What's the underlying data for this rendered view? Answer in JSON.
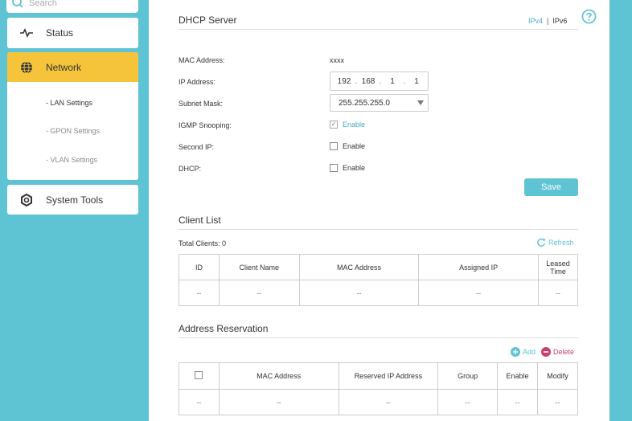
{
  "sidebar": {
    "search_placeholder": "Search",
    "status_label": "Status",
    "network_label": "Network",
    "network_items": [
      "- LAN Settings",
      "- GPON Settings",
      "- VLAN Settings"
    ],
    "system_tools_label": "System Tools"
  },
  "dhcp": {
    "title": "DHCP Server",
    "ipv4_label": "IPv4",
    "separator": "|",
    "ipv6_label": "IPv6",
    "mac_label": "MAC Address:",
    "mac_value": "xxxx",
    "ip_label": "IP Address:",
    "ip_octets": [
      "192",
      "168",
      "1",
      "1"
    ],
    "ip_dot": ".",
    "subnet_label": "Subnet Mask:",
    "subnet_value": "255.255.255.0",
    "igmp_label": "IGMP Snooping:",
    "second_ip_label": "Second IP:",
    "dhcp_label": "DHCP:",
    "enable_label": "Enable",
    "igmp_checked": true,
    "second_ip_checked": false,
    "dhcp_checked": false,
    "save_label": "Save"
  },
  "client_list": {
    "title": "Client List",
    "total_label": "Total Clients: 0",
    "refresh_label": "Refresh",
    "columns": [
      "ID",
      "Client Name",
      "MAC Address",
      "Assigned IP",
      "Leased Time"
    ],
    "rows": [
      [
        "--",
        "--",
        "--",
        "--",
        "--"
      ]
    ]
  },
  "reservation": {
    "title": "Address Reservation",
    "add_label": "Add",
    "delete_label": "Delete",
    "columns": [
      "",
      "MAC Address",
      "Reserved IP Address",
      "Group",
      "Enable",
      "Modify"
    ],
    "rows": [
      [
        "--",
        "--",
        "--",
        "--",
        "--",
        "--"
      ]
    ]
  },
  "colors": {
    "accent": "#5ec3d3",
    "active_menu": "#f5c43a",
    "delete": "#c9416e"
  }
}
